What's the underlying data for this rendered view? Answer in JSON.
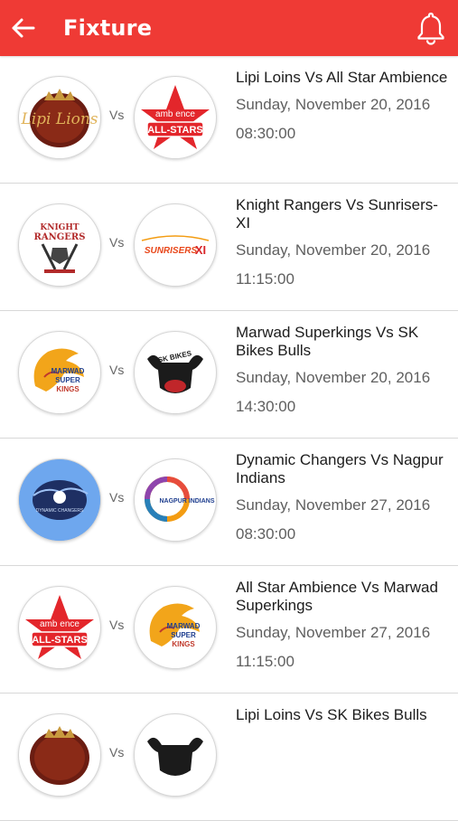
{
  "header": {
    "title": "Fixture",
    "back_icon": "arrow-left-icon",
    "bell_icon": "bell-icon",
    "accent": "#ef3a35"
  },
  "vs_label": "Vs",
  "fixtures": [
    {
      "match": "Lipi Loins Vs All Star Ambience",
      "date": "Sunday, November 20, 2016",
      "time": "08:30:00",
      "team1": "Lipi Loins",
      "team2": "All Star Ambience"
    },
    {
      "match": "Knight Rangers Vs Sunrisers-XI",
      "date": "Sunday, November 20, 2016",
      "time": "11:15:00",
      "team1": "Knight Rangers",
      "team2": "Sunrisers-XI"
    },
    {
      "match": "Marwad Superkings Vs SK Bikes Bulls",
      "date": "Sunday, November 20, 2016",
      "time": "14:30:00",
      "team1": "Marwad Superkings",
      "team2": "SK Bikes Bulls"
    },
    {
      "match": "Dynamic Changers Vs Nagpur Indians",
      "date": "Sunday, November 27, 2016",
      "time": "08:30:00",
      "team1": "Dynamic Changers",
      "team2": "Nagpur Indians"
    },
    {
      "match": "All Star Ambience Vs Marwad Superkings",
      "date": "Sunday, November 27, 2016",
      "time": "11:15:00",
      "team1": "All Star Ambience",
      "team2": "Marwad Superkings"
    },
    {
      "match": "Lipi Loins Vs SK Bikes Bulls",
      "date": "",
      "time": "",
      "team1": "Lipi Loins",
      "team2": "SK Bikes Bulls"
    }
  ],
  "logo_text": {
    "lipi": "Lipi Lions",
    "allstars_top": "amb ence",
    "allstars_bottom": "ALL-STARS",
    "knight_top": "KNIGHT",
    "knight_bottom": "RANGERS",
    "sunrisers": "SUNRISERS",
    "sunrisers_xi": "XI",
    "marwad_1": "MARWAD",
    "marwad_2": "SUPER",
    "marwad_3": "KINGS",
    "skbikes": "SK BIKES",
    "nagpur": "NAGPUR INDIANS",
    "dynamic": "DYNAMIC CHANGERS"
  }
}
